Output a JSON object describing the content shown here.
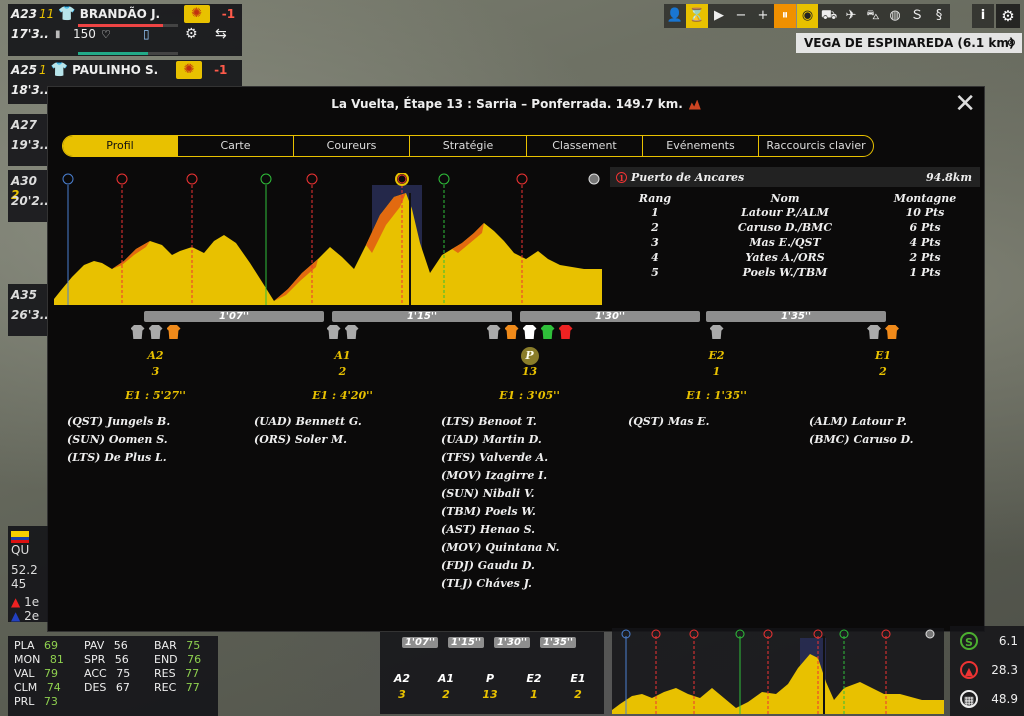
{
  "riders": [
    {
      "pos": "A23",
      "num": "11",
      "name": "BRANDÃO J.",
      "delta": "-1",
      "time": "17'3..",
      "energy": "150"
    },
    {
      "pos": "A25",
      "num": "1",
      "name": "PAULINHO S.",
      "delta": "-1",
      "time": "18'3.."
    }
  ],
  "collapsed_cards": [
    {
      "pos": "A27",
      "time": "19'3.."
    },
    {
      "pos": "A30",
      "num": "2",
      "time": "20'2.."
    },
    {
      "pos": "A35",
      "time": "26'3.."
    }
  ],
  "location": {
    "name": "VEGA DE ESPINAREDA (6.1 km)",
    "close": "⊗"
  },
  "toolbar": {
    "info": "i",
    "settings": "⚙"
  },
  "modal": {
    "title": "La Vuelta, Étape 13 : Sarria – Ponferrada. 149.7 km.",
    "close": "✕",
    "tabs": [
      "Profil",
      "Carte",
      "Coureurs",
      "Stratégie",
      "Classement",
      "Evénements",
      "Raccourcis clavier"
    ],
    "selected_tab": "Profil",
    "climb": {
      "rank_icon": "1",
      "name": "Puerto de Ancares",
      "km": "94.8km",
      "headers": [
        "Rang",
        "Nom",
        "Montagne"
      ],
      "rows": [
        [
          "1",
          "Latour P./ALM",
          "10 Pts"
        ],
        [
          "2",
          "Caruso D./BMC",
          "6 Pts"
        ],
        [
          "3",
          "Mas E./QST",
          "4 Pts"
        ],
        [
          "4",
          "Yates A./ORS",
          "2 Pts"
        ],
        [
          "5",
          "Poels W./TBM",
          "1 Pts"
        ]
      ]
    },
    "gaps": [
      "1'07''",
      "1'15''",
      "1'30''",
      "1'35''"
    ],
    "groups": [
      {
        "label": "A2",
        "count": "3",
        "time": "E1 : 5'27''",
        "riders": [
          "(QST) Jungels B.",
          "(SUN) Oomen S.",
          "(LTS) De Plus L."
        ]
      },
      {
        "label": "A1",
        "count": "2",
        "time": "E1 : 4'20''",
        "riders": [
          "(UAD) Bennett G.",
          "(ORS) Soler M."
        ]
      },
      {
        "label": "P",
        "count": "13",
        "time": "E1 : 3'05''",
        "riders": [
          "(LTS) Benoot T.",
          "(UAD) Martin D.",
          "(TFS) Valverde A.",
          "(MOV) Izagirre I.",
          "(SUN) Nibali V.",
          "(TBM) Poels W.",
          "(AST) Henao S.",
          "(MOV) Quintana N.",
          "(FDJ) Gaudu D.",
          "(TLJ) Cháves J."
        ]
      },
      {
        "label": "E2",
        "count": "1",
        "time": "E1 : 1'35''",
        "riders": [
          "(QST) Mas E."
        ]
      },
      {
        "label": "E1",
        "count": "2",
        "time": "",
        "riders": [
          "(ALM) Latour P.",
          "(BMC) Caruso D."
        ]
      }
    ]
  },
  "side_panel": {
    "flag_label": "QU",
    "v1": "52.2",
    "v2": "45",
    "r1": "1e",
    "r2": "2e"
  },
  "stats": [
    {
      "k": "PLA",
      "v": "69"
    },
    {
      "k": "MON",
      "v": "81"
    },
    {
      "k": "VAL",
      "v": "79"
    },
    {
      "k": "CLM",
      "v": "74"
    },
    {
      "k": "PRL",
      "v": "73"
    },
    {
      "k": "PAV",
      "v": "56"
    },
    {
      "k": "SPR",
      "v": "56"
    },
    {
      "k": "ACC",
      "v": "75"
    },
    {
      "k": "DES",
      "v": "67"
    },
    {
      "k": "BAR",
      "v": "75"
    },
    {
      "k": "END",
      "v": "76"
    },
    {
      "k": "RES",
      "v": "77"
    },
    {
      "k": "REC",
      "v": "77"
    }
  ],
  "mini": {
    "gaps": [
      "1'07''",
      "1'15''",
      "1'30''",
      "1'35''"
    ],
    "groups": [
      {
        "l": "A2",
        "c": "3"
      },
      {
        "l": "A1",
        "c": "2"
      },
      {
        "l": "P",
        "c": "13"
      },
      {
        "l": "E2",
        "c": "1"
      },
      {
        "l": "E1",
        "c": "2"
      }
    ]
  },
  "distances": [
    {
      "icon": "S",
      "value": "6.1",
      "color": "#4caf30"
    },
    {
      "icon": "▲",
      "value": "28.3",
      "color": "#e33"
    },
    {
      "icon": "▦",
      "value": "48.9",
      "color": "#eee"
    }
  ],
  "colors": {
    "accent": "#e8c100",
    "profile": "#e8c100",
    "sprint": "#2fbf3a",
    "climb": "#e33"
  }
}
